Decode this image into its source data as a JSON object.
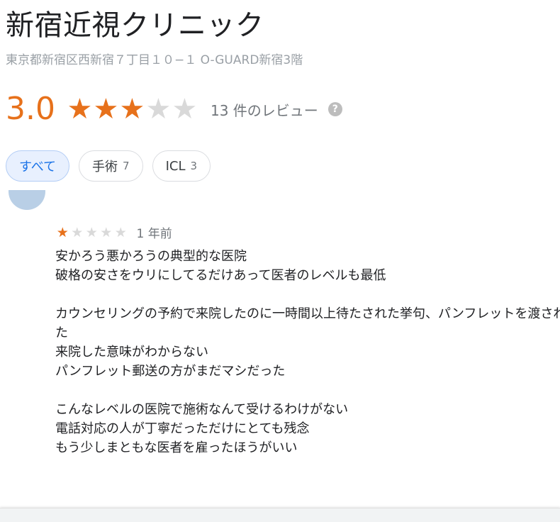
{
  "place": {
    "title": "新宿近視クリニック",
    "address": "東京都新宿区西新宿７丁目１０−１ O-GUARD新宿3階"
  },
  "rating": {
    "value": "3.0",
    "stars": 3,
    "max_stars": 5,
    "star_glyph": "★",
    "review_count_label": "13 件のレビュー",
    "help_icon": "?"
  },
  "filters": [
    {
      "label": "すべて",
      "count": "",
      "active": true
    },
    {
      "label": "手術",
      "count": "7",
      "active": false
    },
    {
      "label": "ICL",
      "count": "3",
      "active": false
    }
  ],
  "review": {
    "reviewer_name": "",
    "stars": 1,
    "max_stars": 5,
    "date": "1 年前",
    "lines": [
      "安かろう悪かろうの典型的な医院",
      "破格の安さをウリにしてるだけあって医者のレベルも最低",
      "",
      "カウンセリングの予約で来院したのに一時間以上待たされた挙句、パンフレットを渡されただけで帰され",
      "た",
      "来院した意味がわからない",
      "パンフレット郵送の方がまだマシだった",
      "",
      "こんなレベルの医院で施術なんて受けるわけがない",
      "電話対応の人が丁寧だっただけにとても残念",
      "もう少しまともな医者を雇ったほうがいい"
    ]
  },
  "colors": {
    "accent_orange": "#e7711b",
    "star_empty": "#d9d9d9",
    "chip_active_bg": "#e8f0fe",
    "chip_active_text": "#1a73e8"
  }
}
